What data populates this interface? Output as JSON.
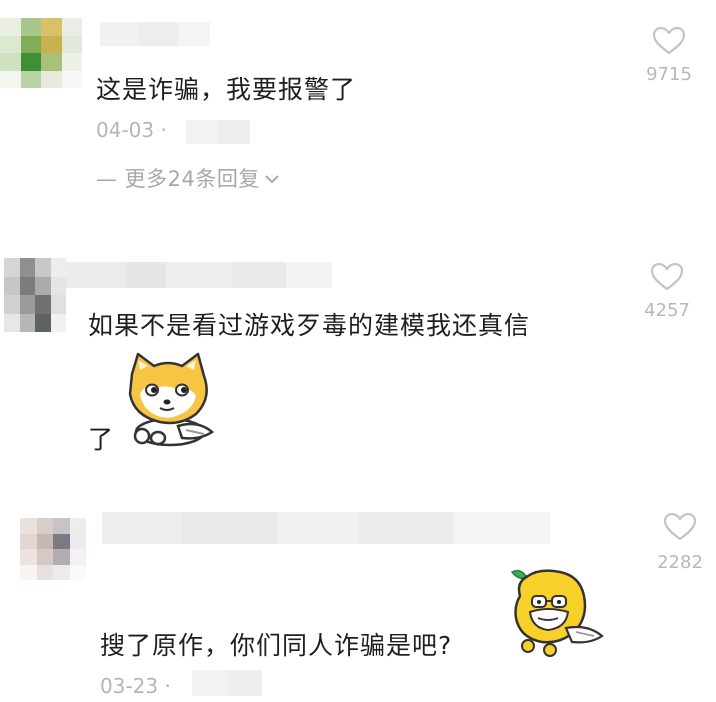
{
  "comments": [
    {
      "text": "这是诈骗，我要报警了",
      "date": "04-03 ·",
      "likes": "9715",
      "more_replies": "— 更多24条回复",
      "more_icon": "chevron-down-icon"
    },
    {
      "text_line1": "如果不是看过游戏歹毒的建模我还真信",
      "text_line2": "了",
      "likes": "4257",
      "sticker": "shiba-dog-sticker"
    },
    {
      "text": "搜了原作，你们同人诈骗是吧?",
      "date": "03-23 ·",
      "likes": "2282",
      "sticker": "lemon-character-sticker"
    }
  ],
  "icons": {
    "like": "heart-outline-icon"
  },
  "colors": {
    "primary_text": "#1f1f1f",
    "secondary_text": "#b5b5b5",
    "heart": "#c4c4c4"
  }
}
